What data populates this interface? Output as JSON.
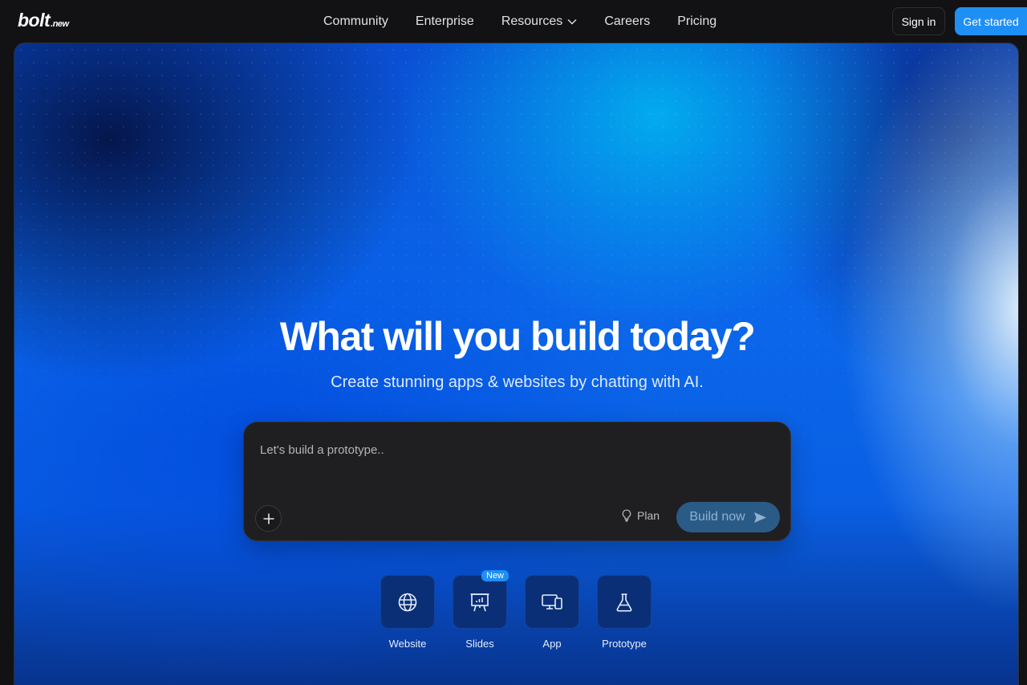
{
  "brand": {
    "logo_main": "bolt",
    "logo_suffix": ".new"
  },
  "nav": {
    "links": [
      {
        "label": "Community"
      },
      {
        "label": "Enterprise"
      },
      {
        "label": "Resources",
        "icon": "chevron-down-icon"
      },
      {
        "label": "Careers"
      },
      {
        "label": "Pricing"
      }
    ],
    "sign_in": "Sign in",
    "get_started": "Get started"
  },
  "hero": {
    "title": "What will you build today?",
    "subtitle": "Create stunning apps & websites by chatting with AI."
  },
  "prompt": {
    "placeholder": "Let's build a prototype..",
    "value": "",
    "plan_label": "Plan",
    "build_label": "Build now"
  },
  "tiles": [
    {
      "label": "Website",
      "icon": "globe-icon"
    },
    {
      "label": "Slides",
      "icon": "presentation-icon",
      "badge": "New"
    },
    {
      "label": "App",
      "icon": "devices-icon"
    },
    {
      "label": "Prototype",
      "icon": "flask-icon"
    }
  ],
  "colors": {
    "accent": "#1e8ff5",
    "page_bg": "#121214",
    "prompt_bg": "#1f1f22",
    "tile_bg": "#0b2f76"
  }
}
